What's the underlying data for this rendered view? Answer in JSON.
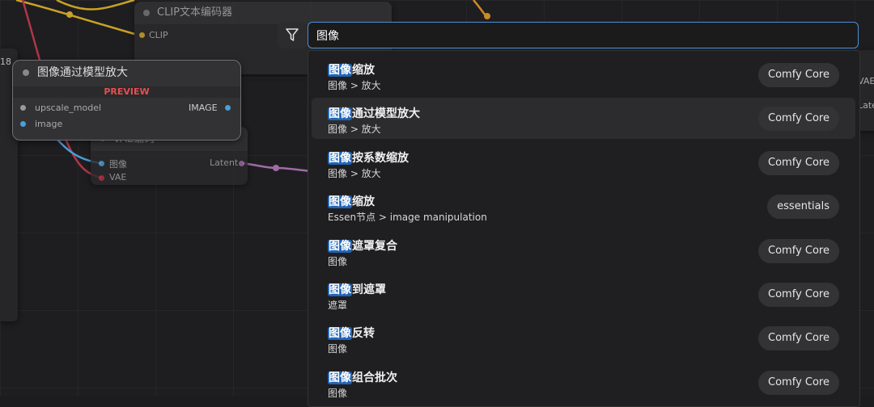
{
  "canvas": {
    "bg_nodes": {
      "clip_title": "CLIP文本编码器",
      "clip_input": "CLIP",
      "vae_title": "VAE编码",
      "vae_in_image": "图像",
      "vae_in_vae": "VAE",
      "vae_out_latent": "Latent",
      "left_number": "18",
      "right_text_1": "VAE",
      "right_text_2": "Latent"
    },
    "upscale_node": {
      "title": "图像通过模型放大",
      "preview_label": "PREVIEW",
      "input_1": "upscale_model",
      "input_2": "image",
      "output_1": "IMAGE"
    }
  },
  "search": {
    "query": "图像",
    "filter_icon": "filter-icon"
  },
  "results": [
    {
      "highlight": "图像",
      "rest": "缩放",
      "category": "图像 > 放大",
      "source": "Comfy Core",
      "active": false
    },
    {
      "highlight": "图像",
      "rest": "通过模型放大",
      "category": "图像 > 放大",
      "source": "Comfy Core",
      "active": true
    },
    {
      "highlight": "图像",
      "rest": "按系数缩放",
      "category": "图像 > 放大",
      "source": "Comfy Core",
      "active": false
    },
    {
      "highlight": "图像",
      "rest": "缩放",
      "category": "Essen节点 > image manipulation",
      "source": "essentials",
      "active": false
    },
    {
      "highlight": "图像",
      "rest": "遮罩复合",
      "category": "图像",
      "source": "Comfy Core",
      "active": false
    },
    {
      "highlight": "图像",
      "rest": "到遮罩",
      "category": "遮罩",
      "source": "Comfy Core",
      "active": false
    },
    {
      "highlight": "图像",
      "rest": "反转",
      "category": "图像",
      "source": "Comfy Core",
      "active": false
    },
    {
      "highlight": "图像",
      "rest": "组合批次",
      "category": "图像",
      "source": "Comfy Core",
      "active": false
    }
  ],
  "colors": {
    "accent": "#4c8fd6",
    "highlight": "#1f64b8",
    "wire_yellow": "#c9a227",
    "wire_red": "#b03548",
    "wire_purple": "#a06ba8",
    "wire_blue": "#4a9fd8",
    "preview_red": "#e35050"
  }
}
